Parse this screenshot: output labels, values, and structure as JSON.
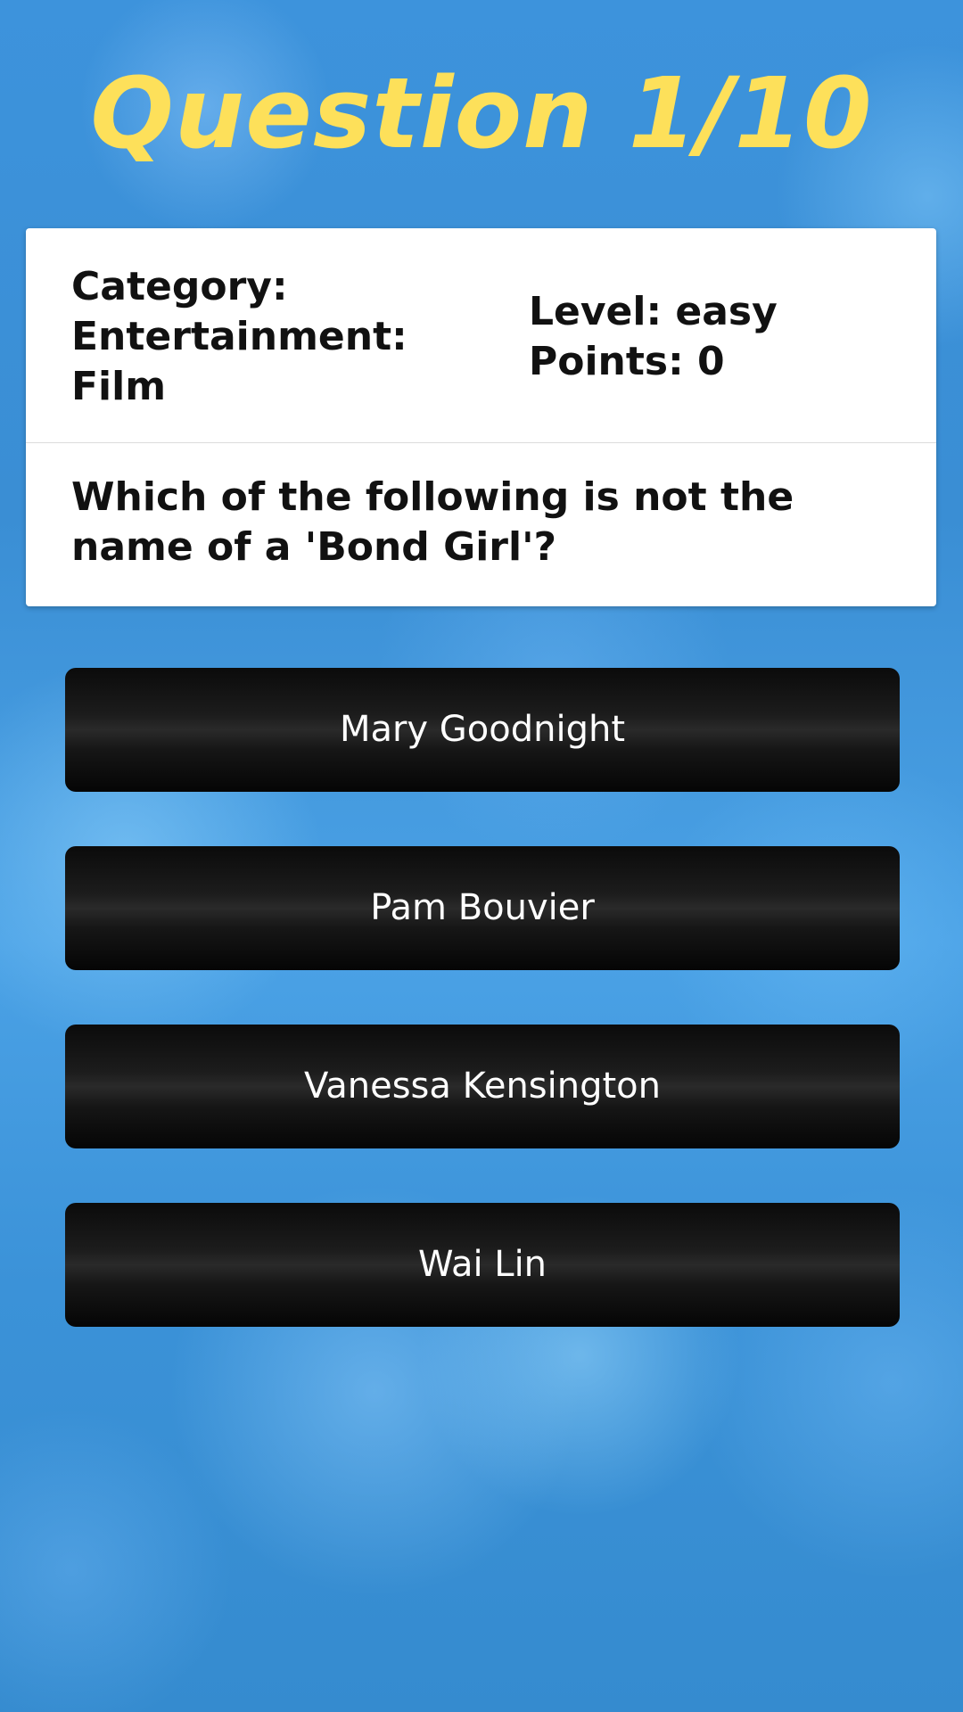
{
  "header": {
    "title": "Question 1/10"
  },
  "card": {
    "category_label": "Category:",
    "category_value": "Entertainment: Film",
    "level": "Level: easy",
    "points": "Points: 0",
    "question": "Which of the following is not the name of a 'Bond Girl'?"
  },
  "answers": [
    {
      "label": "Mary Goodnight"
    },
    {
      "label": "Pam Bouvier"
    },
    {
      "label": "Vanessa Kensington"
    },
    {
      "label": "Wai Lin"
    }
  ],
  "colors": {
    "title": "#fde05a",
    "background": "#3a8fd6",
    "card": "#ffffff",
    "answer_button": "#1c1c1c"
  }
}
